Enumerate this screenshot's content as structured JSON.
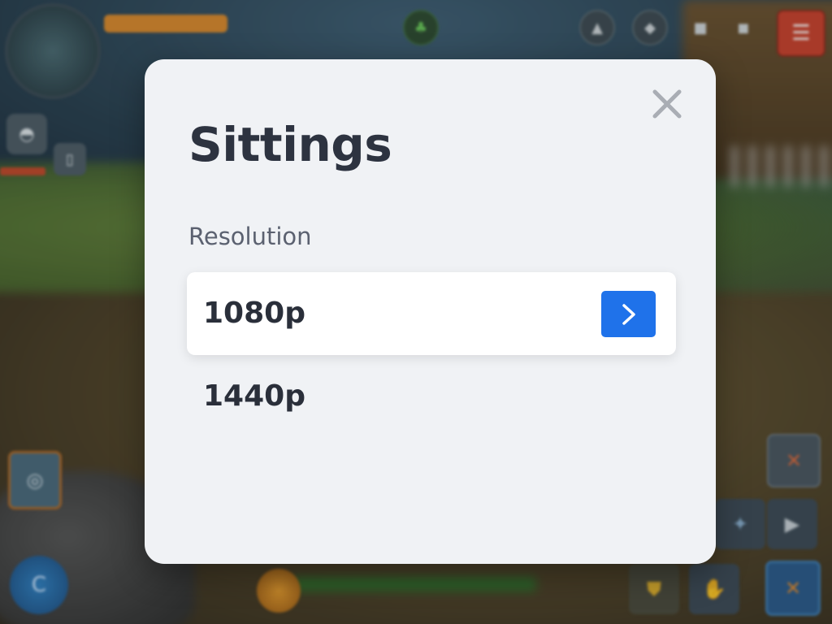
{
  "modal": {
    "title": "Sittings",
    "section_label": "Resolution",
    "options": [
      {
        "label": "1080p",
        "selected": true
      },
      {
        "label": "1440p",
        "selected": false
      }
    ],
    "close_icon": "close-icon",
    "select_icon": "chevron-right-icon",
    "colors": {
      "panel": "#f0f2f5",
      "accent": "#1f72ea",
      "title": "#2d3340",
      "label": "#5b6170"
    }
  }
}
